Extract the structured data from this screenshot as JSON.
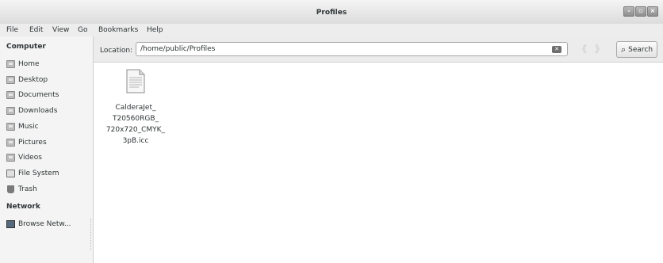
{
  "window": {
    "title": "Profiles",
    "controls": [
      "-",
      "▫",
      "×"
    ]
  },
  "menubar": {
    "items": [
      "File",
      "Edit",
      "View",
      "Go",
      "Bookmarks",
      "Help"
    ]
  },
  "sidebar": {
    "computer_heading": "Computer",
    "computer_items": [
      {
        "label": "Home",
        "icon": "home-folder-icon"
      },
      {
        "label": "Desktop",
        "icon": "desktop-folder-icon"
      },
      {
        "label": "Documents",
        "icon": "documents-folder-icon"
      },
      {
        "label": "Downloads",
        "icon": "downloads-folder-icon"
      },
      {
        "label": "Music",
        "icon": "music-folder-icon"
      },
      {
        "label": "Pictures",
        "icon": "pictures-folder-icon"
      },
      {
        "label": "Videos",
        "icon": "videos-folder-icon"
      },
      {
        "label": "File System",
        "icon": "filesystem-icon"
      },
      {
        "label": "Trash",
        "icon": "trash-icon"
      }
    ],
    "network_heading": "Network",
    "network_items": [
      {
        "label": "Browse Netw...",
        "icon": "network-icon"
      }
    ]
  },
  "location": {
    "label": "Location:",
    "path": "/home/public/Profiles",
    "clear_icon": "clear-text-icon"
  },
  "navigation": {
    "back_glyph": "《",
    "forward_glyph": "》"
  },
  "search": {
    "label": "Search",
    "icon": "magnifier-icon"
  },
  "files": [
    {
      "name_lines": [
        "CalderaJet_",
        "T20560RGB_",
        "720x720_CMYK_",
        "3pB.icc"
      ],
      "icon": "text-file-icon"
    }
  ]
}
